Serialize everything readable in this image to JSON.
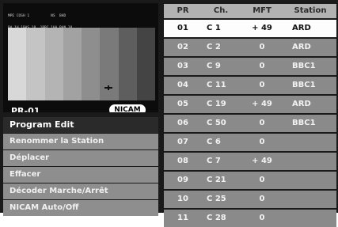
{
  "preview": {
    "osd_lines": [
      "MPE COSH 1          NS  BHD",
      "BA.1H 1BAS.18  1BBC.1HA BAN.18",
      "IBSSA.UBA.2  1ANNG.3AHA 3PTT.M"
    ],
    "bar_colors": [
      "#d8d8d8",
      "#c4c4c4",
      "#b4b4b4",
      "#a2a2a2",
      "#8e8e8e",
      "#7a7a7a",
      "#5e5e5e",
      "#444444"
    ],
    "program_label": "PR-01",
    "badge": "NICAM"
  },
  "menu": {
    "items": [
      {
        "label": "Program Edit",
        "active": true
      },
      {
        "label": "Renommer la Station",
        "active": false
      },
      {
        "label": "Déplacer",
        "active": false
      },
      {
        "label": "Effacer",
        "active": false
      },
      {
        "label": "Décoder  Marche/Arrêt",
        "active": false
      },
      {
        "label": "NICAM Auto/Off",
        "active": false
      }
    ]
  },
  "table": {
    "headers": {
      "pr": "PR",
      "ch": "Ch.",
      "mft": "MFT",
      "station": "Station"
    },
    "rows": [
      {
        "pr": "01",
        "ch": "C 1",
        "mft": "+ 49",
        "station": "ARD",
        "selected": true
      },
      {
        "pr": "02",
        "ch": "C 2",
        "mft": "0",
        "station": "ARD",
        "selected": false
      },
      {
        "pr": "03",
        "ch": "C 9",
        "mft": "0",
        "station": "BBC1",
        "selected": false
      },
      {
        "pr": "04",
        "ch": "C 11",
        "mft": "0",
        "station": "BBC1",
        "selected": false
      },
      {
        "pr": "05",
        "ch": "C 19",
        "mft": "+ 49",
        "station": "ARD",
        "selected": false
      },
      {
        "pr": "06",
        "ch": "C 50",
        "mft": "0",
        "station": "BBC1",
        "selected": false
      },
      {
        "pr": "07",
        "ch": "C 6",
        "mft": "0",
        "station": "",
        "selected": false
      },
      {
        "pr": "08",
        "ch": "C 7",
        "mft": "+ 49",
        "station": "",
        "selected": false
      },
      {
        "pr": "09",
        "ch": "C 21",
        "mft": "0",
        "station": "",
        "selected": false
      },
      {
        "pr": "10",
        "ch": "C 25",
        "mft": "0",
        "station": "",
        "selected": false
      },
      {
        "pr": "11",
        "ch": "C 28",
        "mft": "0",
        "station": "",
        "selected": false
      }
    ]
  }
}
